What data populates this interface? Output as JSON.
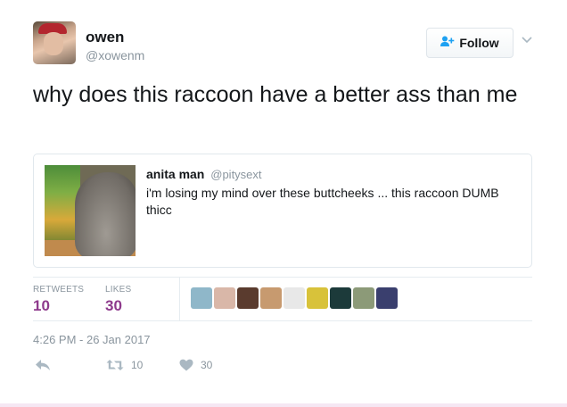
{
  "user": {
    "name": "owen",
    "handle": "@xowenm"
  },
  "follow_button": {
    "label": "Follow",
    "icon": "person-add-icon"
  },
  "tweet": {
    "text": "why does this raccoon have a better ass than me"
  },
  "quoted_tweet": {
    "author_name": "anita man",
    "author_handle": "@pitysext",
    "text": "i'm losing my mind over these buttcheeks ... this raccoon DUMB thicc"
  },
  "stats": {
    "retweets_label": "RETWEETS",
    "retweets_count": "10",
    "likes_label": "LIKES",
    "likes_count": "30"
  },
  "likers": [
    {
      "color": "#8fb7c9"
    },
    {
      "color": "#d9b7a8"
    },
    {
      "color": "#5a3b2e"
    },
    {
      "color": "#c79a6f"
    },
    {
      "color": "#e8e8e8"
    },
    {
      "color": "#d8c23a"
    },
    {
      "color": "#1c3a3a"
    },
    {
      "color": "#8c9a78"
    },
    {
      "color": "#3a3f6e"
    }
  ],
  "timestamp": "4:26 PM - 26 Jan 2017",
  "actions": {
    "retweet_count": "10",
    "like_count": "30"
  },
  "colors": {
    "accent_count": "#8e3a8c",
    "brand_blue": "#1da1f2",
    "muted_text": "#8a959e"
  }
}
